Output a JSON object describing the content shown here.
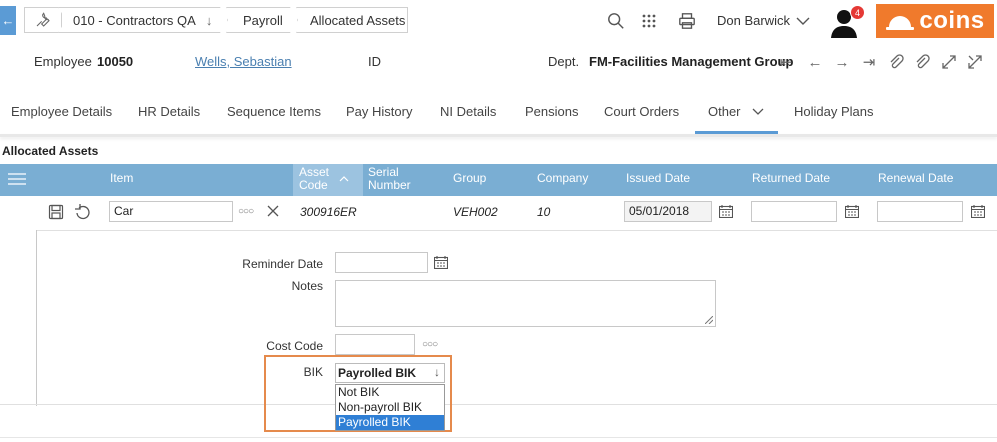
{
  "header": {
    "breadcrumbs": [
      "010 - Contractors QA",
      "Payroll",
      "Allocated Assets"
    ],
    "user_name": "Don Barwick",
    "notification_count": "4",
    "logo_text": "coins",
    "icons": [
      "wrench-icon",
      "chevron-down-icon",
      "search-icon",
      "grid-icon",
      "printer-icon",
      "user-icon"
    ]
  },
  "info": {
    "employee_label": "Employee",
    "employee_number": "10050",
    "employee_name": "Wells, Sebastian",
    "id_label": "ID",
    "dept_label": "Dept.",
    "dept_value": "FM-Facilities Management Group"
  },
  "tabs": [
    {
      "label": "Employee Details"
    },
    {
      "label": "HR Details"
    },
    {
      "label": "Sequence Items"
    },
    {
      "label": "Pay History"
    },
    {
      "label": "NI Details"
    },
    {
      "label": "Pensions"
    },
    {
      "label": "Court Orders"
    },
    {
      "label": "Other",
      "active": true
    },
    {
      "label": "Holiday Plans"
    }
  ],
  "section_title": "Allocated Assets",
  "grid": {
    "columns": {
      "item": "Item",
      "asset_code_1": "Asset",
      "asset_code_2": "Code",
      "serial_1": "Serial",
      "serial_2": "Number",
      "group": "Group",
      "company": "Company",
      "issued": "Issued Date",
      "returned": "Returned Date",
      "renewal": "Renewal Date"
    },
    "row": {
      "item": "Car",
      "asset_code": "300916ER",
      "group": "VEH002",
      "company": "10",
      "issued_date": "05/01/2018",
      "returned_date": "",
      "renewal_date": ""
    }
  },
  "detail": {
    "reminder_label": "Reminder Date",
    "notes_label": "Notes",
    "cost_code_label": "Cost Code",
    "bik_label": "BIK",
    "bik_selected": "Payrolled BIK",
    "bik_options": [
      "Not BIK",
      "Non-payroll BIK",
      "Payrolled BIK"
    ]
  },
  "colors": {
    "accent": "#5b9bd5",
    "grid_header": "#7aaed3",
    "logo": "#f07a2c",
    "highlight": "#e58a4c",
    "badge": "#e53935"
  }
}
